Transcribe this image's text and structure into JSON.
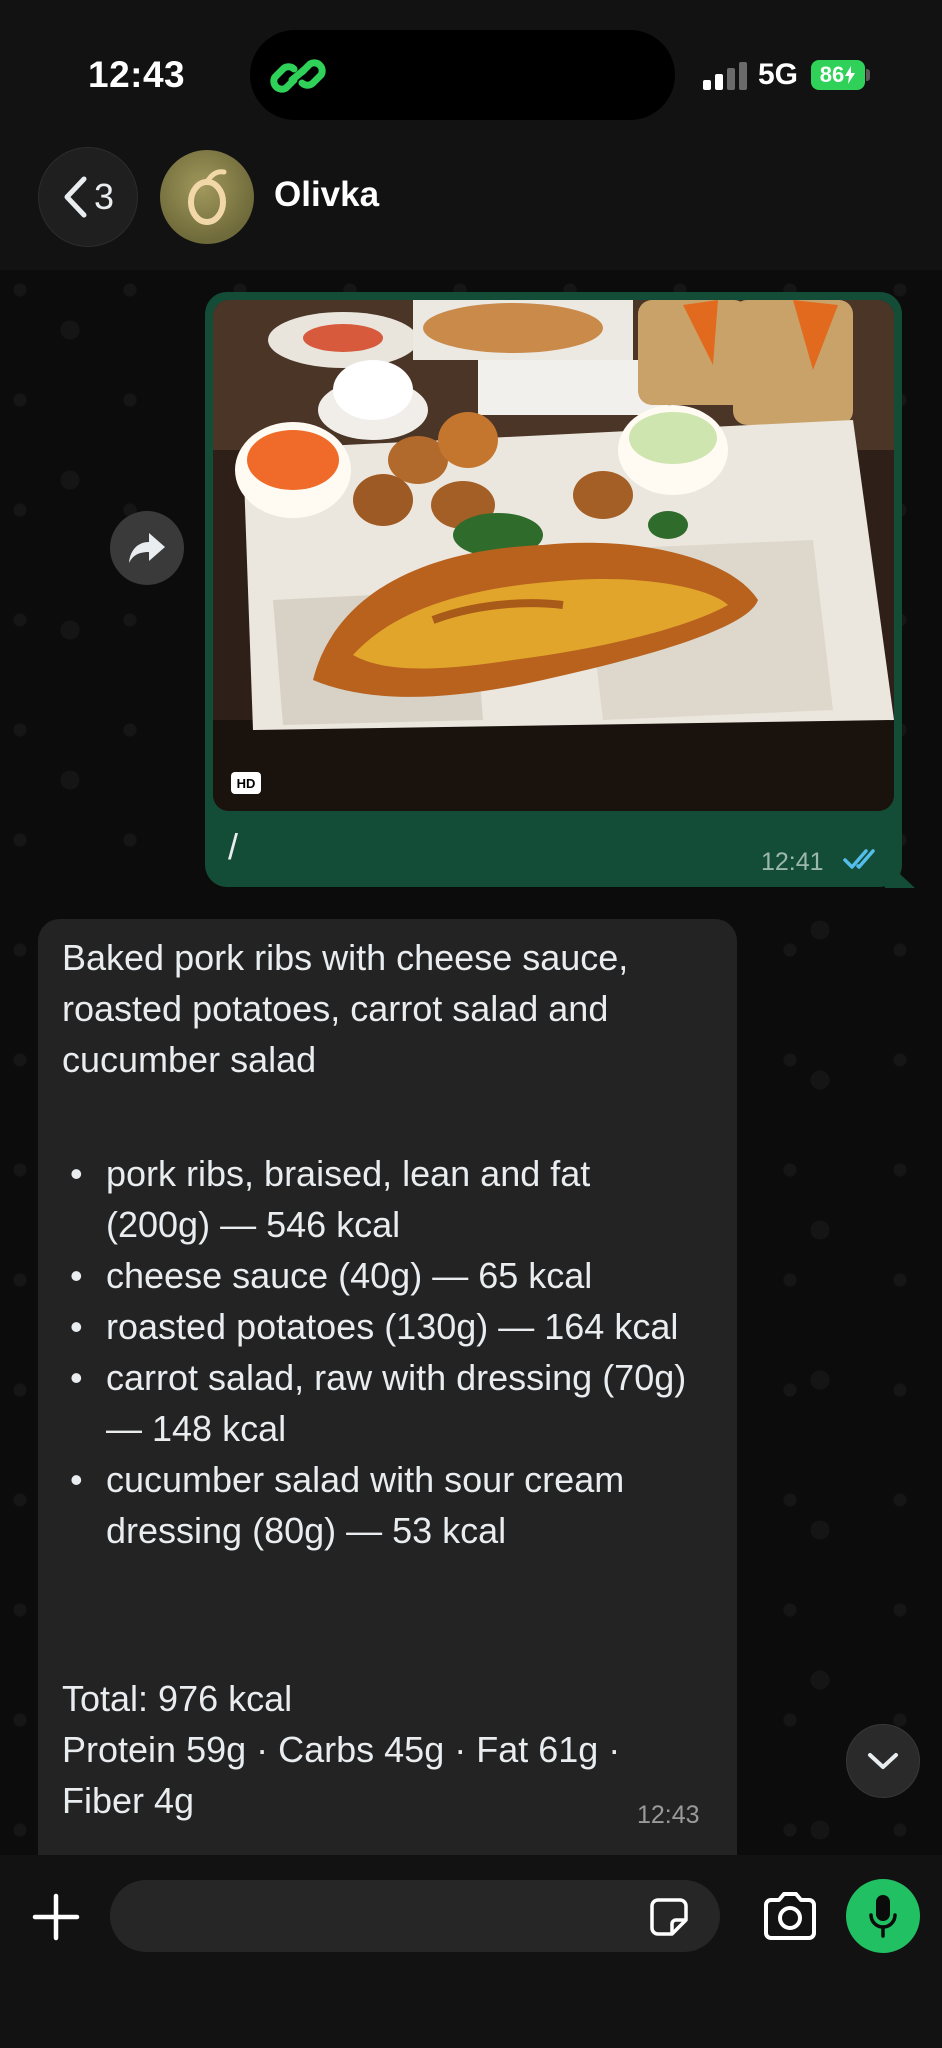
{
  "status_bar": {
    "time": "12:43",
    "network": "5G",
    "battery": "86"
  },
  "header": {
    "back_count": "3",
    "contact_name": "Olivka"
  },
  "outgoing_message": {
    "photo_badge": "HD",
    "text": "/",
    "time": "12:41",
    "status": "read"
  },
  "incoming_message": {
    "title": "Baked pork ribs with cheese sauce, roasted potatoes, carrot salad and cucumber salad",
    "items": [
      "pork ribs, braised, lean and fat (200g) — 546 kcal",
      "cheese sauce (40g) — 65 kcal",
      "roasted potatoes (130g) — 164 kcal",
      "carrot salad, raw with dressing (70g) — 148 kcal",
      "cucumber salad with sour cream dressing (80g) — 53 kcal"
    ],
    "total": "Total: 976 kcal",
    "macros": "Protein 59g · Carbs 45g · Fat 61g · Fiber 4g",
    "time": "12:43"
  },
  "composer": {
    "placeholder": ""
  },
  "colors": {
    "outgoing_bubble": "#144d37",
    "incoming_bubble": "#232323",
    "accent_green": "#21c063",
    "read_ticks": "#53bdeb",
    "battery": "#30d158"
  }
}
